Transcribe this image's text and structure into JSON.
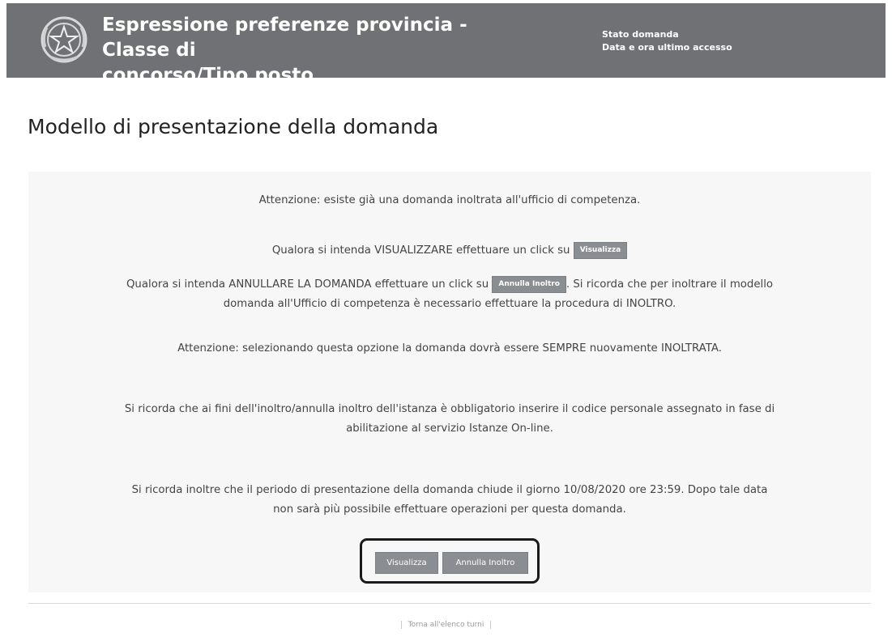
{
  "header": {
    "title_line1": "Espressione preferenze provincia - Classe di",
    "title_line2": "concorso/Tipo posto",
    "status_label": "Stato domanda",
    "last_access_label": "Data e ora ultimo accesso",
    "logo_icon": "italian-republic-emblem-icon"
  },
  "page": {
    "title": "Modello di presentazione della domanda"
  },
  "messages": {
    "attention_existing": "Attenzione: esiste già una domanda inoltrata all'ufficio di competenza.",
    "view_prefix": "Qualora si intenda VISUALIZZARE effettuare un click su",
    "view_inline_btn": "Visualizza",
    "cancel_prefix": "Qualora si intenda ANNULLARE LA DOMANDA effettuare un click su",
    "cancel_inline_btn": "Annulla Inoltro",
    "cancel_suffix": ". Si ricorda che per inoltrare il modello",
    "cancel_line2": "domanda all'Ufficio di competenza è necessario effettuare la procedura di INOLTRO.",
    "attention_option": "Attenzione: selezionando questa opzione la domanda dovrà essere SEMPRE nuovamente INOLTRATA.",
    "code_line1": "Si ricorda che ai fini dell'inoltro/annulla inoltro dell'istanza è obbligatorio inserire il codice personale assegnato in fase di",
    "code_line2": "abilitazione al servizio Istanze On-line.",
    "deadline_line1": "Si ricorda inoltre che il periodo di presentazione della domanda chiude il giorno 10/08/2020 ore 23:59. Dopo tale data",
    "deadline_line2": "non sarà più possibile effettuare operazioni per questa domanda."
  },
  "actions": {
    "view_label": "Visualizza",
    "cancel_label": "Annulla Inoltro"
  },
  "footer": {
    "back_link": "Torna all'elenco turni"
  },
  "colors": {
    "header_bg": "#6f7174",
    "button_bg": "#8a8d91",
    "panel_bg": "#f7f7f8"
  }
}
